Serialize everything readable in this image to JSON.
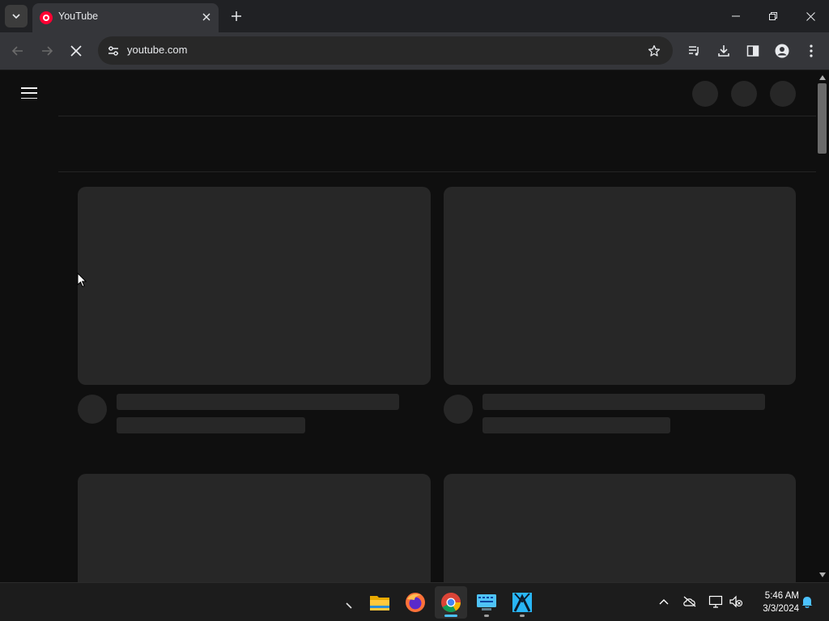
{
  "browser": {
    "tab": {
      "title": "YouTube",
      "favicon": "youtube-icon"
    },
    "address": {
      "url": "youtube.com"
    },
    "icons": {
      "tab_search": "chevron-down-icon",
      "tab_close": "close-icon",
      "new_tab": "plus-icon",
      "minimize": "minimize-icon",
      "restore": "restore-icon",
      "close_window": "close-icon",
      "back": "back-arrow-icon",
      "forward": "forward-arrow-icon",
      "stop": "stop-loading-icon",
      "site_info": "tune-icon",
      "bookmark": "star-icon",
      "media": "media-queue-icon",
      "downloads": "download-icon",
      "side_panel": "side-panel-icon",
      "profile": "profile-icon",
      "menu": "kebab-menu-icon"
    }
  },
  "page": {
    "menu_icon": "hamburger-icon",
    "state": "loading-skeleton"
  },
  "taskbar": {
    "apps": [
      "file-explorer-icon",
      "firefox-icon",
      "chrome-icon",
      "virtual-keyboard-icon",
      "kompozer-icon"
    ],
    "active_app": "chrome-icon",
    "tray": [
      "chevron-up-icon",
      "onedrive-offline-icon",
      "network-icon",
      "volume-muted-icon"
    ],
    "clock": {
      "time": "5:46 AM",
      "date": "3/3/2024"
    },
    "notification_icon": "bell-icon"
  },
  "colors": {
    "page_bg": "#0f0f0f",
    "skeleton": "#272727",
    "chrome_bg": "#202124",
    "toolbar_bg": "#35363a",
    "accent": "#4cc2ff"
  }
}
